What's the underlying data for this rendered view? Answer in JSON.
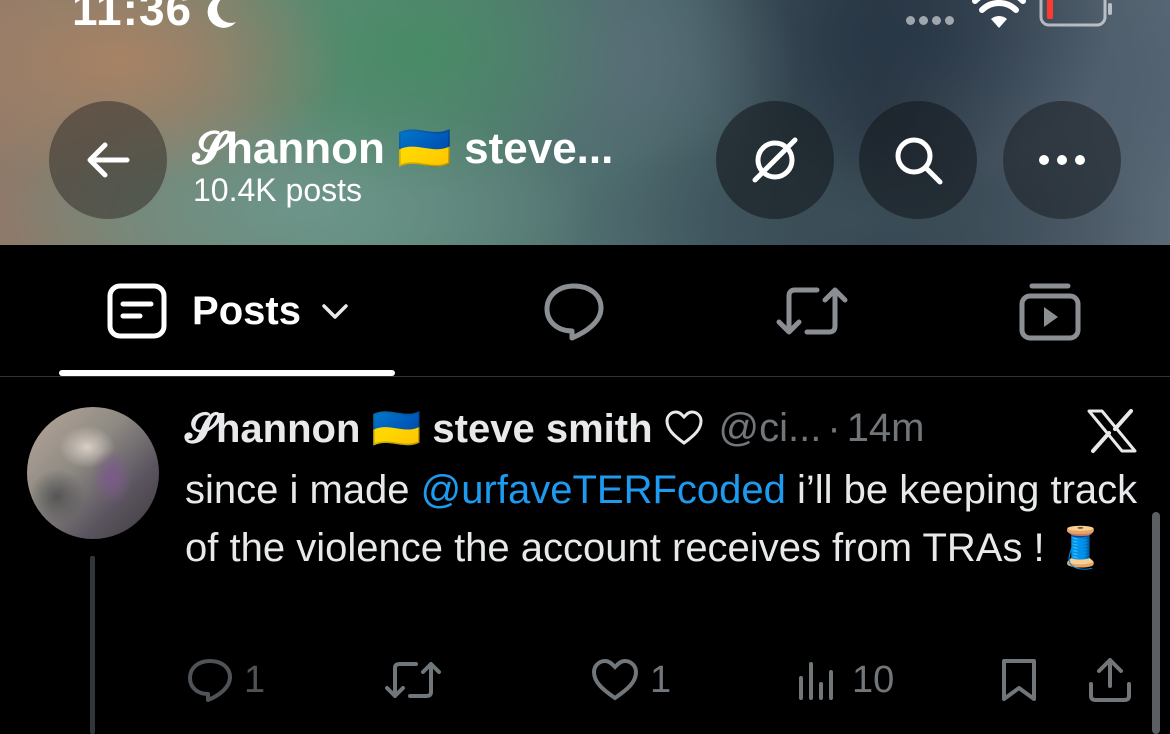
{
  "status_bar": {
    "time": "11:36"
  },
  "header": {
    "profile_name": "𝓢hannon 🇺🇦 steve...",
    "post_count": "10.4K posts"
  },
  "tabs": [
    {
      "label": "Posts",
      "icon": "posts-icon",
      "active": true
    },
    {
      "icon": "speech-bubble-icon"
    },
    {
      "icon": "repost-icon"
    },
    {
      "icon": "media-icon"
    }
  ],
  "tweet": {
    "name": "𝓢hannon 🇺🇦 steve smith",
    "handle": "@ci...",
    "dot": "·",
    "time": "14m",
    "text_before": "since i made ",
    "mention": "@urfaveTERFcoded",
    "text_after": " i’ll be keeping track of the violence the account receives from TRAs ! 🧵",
    "counts": {
      "replies": "1",
      "likes": "1",
      "views": "10"
    }
  },
  "colors": {
    "accent": "#1d9bf0",
    "muted": "#71767b",
    "background": "#000000"
  }
}
